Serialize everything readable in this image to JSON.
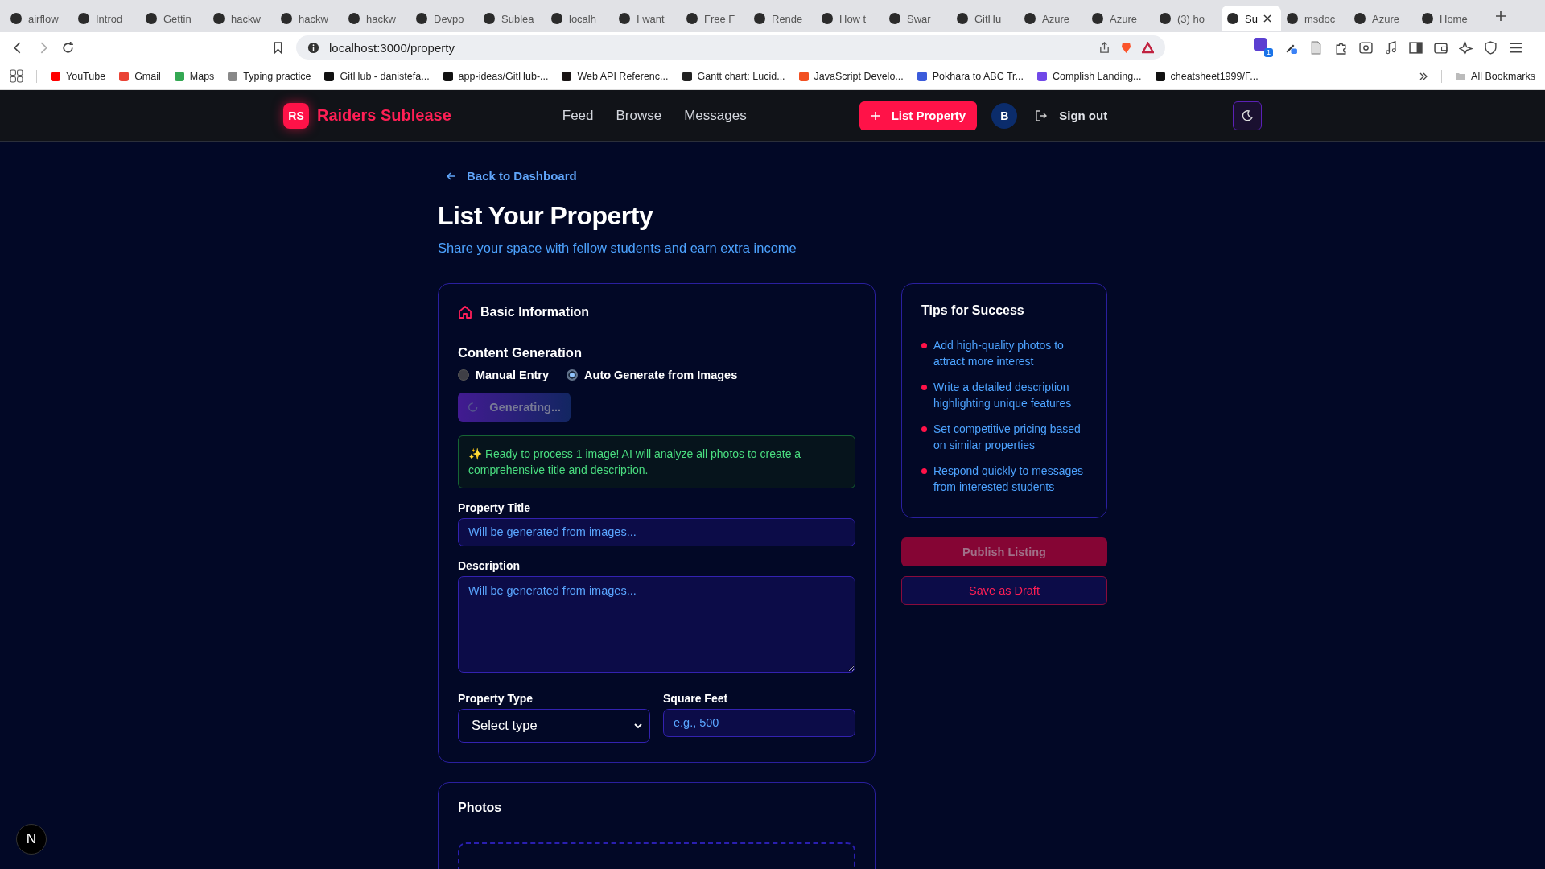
{
  "browser": {
    "tabs": [
      {
        "title": "airflow",
        "selected": false
      },
      {
        "title": "Introd",
        "selected": false
      },
      {
        "title": "Gettin",
        "selected": false
      },
      {
        "title": "hackw",
        "selected": false
      },
      {
        "title": "hackw",
        "selected": false
      },
      {
        "title": "hackw",
        "selected": false
      },
      {
        "title": "Devpo",
        "selected": false
      },
      {
        "title": "Sublea",
        "selected": false
      },
      {
        "title": "localh",
        "selected": false
      },
      {
        "title": "I want",
        "selected": false
      },
      {
        "title": "Free F",
        "selected": false
      },
      {
        "title": "Rende",
        "selected": false
      },
      {
        "title": "How t",
        "selected": false
      },
      {
        "title": "Swar",
        "selected": false
      },
      {
        "title": "GitHu",
        "selected": false
      },
      {
        "title": "Azure",
        "selected": false
      },
      {
        "title": "Azure",
        "selected": false
      },
      {
        "title": "(3) ho",
        "selected": false
      },
      {
        "title": "Su",
        "selected": true
      },
      {
        "title": "msdoc",
        "selected": false
      },
      {
        "title": "Azure",
        "selected": false
      },
      {
        "title": "Home",
        "selected": false
      }
    ],
    "address": "localhost:3000/property",
    "extension_badge": "1",
    "bookmarks": [
      {
        "label": "YouTube",
        "color": "#ff0000"
      },
      {
        "label": "Gmail",
        "color": "#ea4335"
      },
      {
        "label": "Maps",
        "color": "#34a853"
      },
      {
        "label": "Typing practice",
        "color": "#888888"
      },
      {
        "label": "GitHub - danistefa...",
        "color": "#111111"
      },
      {
        "label": "app-ideas/GitHub-...",
        "color": "#111111"
      },
      {
        "label": "Web API Referenc...",
        "color": "#191414"
      },
      {
        "label": "Gantt chart: Lucid...",
        "color": "#222222"
      },
      {
        "label": "JavaScript Develo...",
        "color": "#f25022"
      },
      {
        "label": "Pokhara to ABC Tr...",
        "color": "#3b5bdb"
      },
      {
        "label": "Complish Landing...",
        "color": "#7048e8"
      },
      {
        "label": "cheatsheet1999/F...",
        "color": "#111111"
      }
    ],
    "all_bookmarks": "All Bookmarks"
  },
  "app": {
    "brand": {
      "initials": "RS",
      "name": "Raiders Sublease"
    },
    "nav": [
      {
        "label": "Feed"
      },
      {
        "label": "Browse"
      },
      {
        "label": "Messages"
      }
    ],
    "list_button": "List Property",
    "avatar": "B",
    "sign_out": "Sign out"
  },
  "page": {
    "back_link": "Back to Dashboard",
    "title": "List Your Property",
    "subtitle": "Share your space with fellow students and earn extra income"
  },
  "basic_info": {
    "heading": "Basic Information",
    "content_generation": {
      "label": "Content Generation",
      "options": [
        {
          "label": "Manual Entry",
          "selected": false
        },
        {
          "label": "Auto Generate from Images",
          "selected": true
        }
      ]
    },
    "generate_button": {
      "label": "Generating...",
      "loading": true
    },
    "notice": "✨ Ready to process 1 image! AI will analyze all photos to create a comprehensive title and description.",
    "title_field": {
      "label": "Property Title",
      "placeholder": "Will be generated from images..."
    },
    "description_field": {
      "label": "Description",
      "placeholder": "Will be generated from images..."
    },
    "type_field": {
      "label": "Property Type",
      "value": "Select type"
    },
    "sqft_field": {
      "label": "Square Feet",
      "placeholder": "e.g., 500"
    }
  },
  "tips": {
    "heading": "Tips for Success",
    "items": [
      {
        "text": "Add high-quality photos to attract more interest"
      },
      {
        "text": "Write a detailed description highlighting unique features"
      },
      {
        "text": "Set competitive pricing based on similar properties"
      },
      {
        "text": "Respond quickly to messages from interested students"
      }
    ]
  },
  "publish_button": {
    "label": "Publish Listing",
    "disabled": true
  },
  "draft_button": {
    "label": "Save as Draft"
  },
  "photos": {
    "heading": "Photos"
  },
  "dev_badge": "N"
}
